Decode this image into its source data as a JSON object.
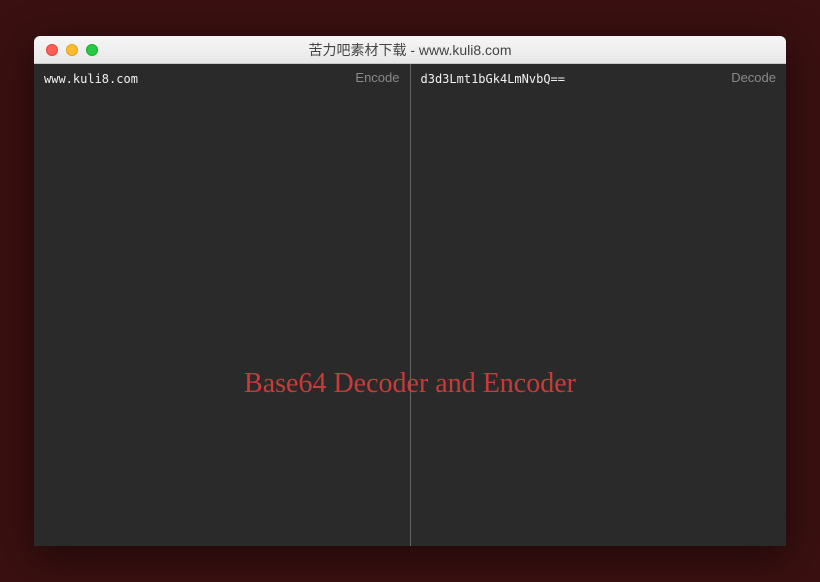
{
  "window": {
    "title": "苦力吧素材下载 - www.kuli8.com"
  },
  "panes": {
    "left": {
      "label": "Encode",
      "content": "www.kuli8.com"
    },
    "right": {
      "label": "Decode",
      "content": "d3d3Lmt1bGk4LmNvbQ=="
    }
  },
  "overlay": {
    "title": "Base64 Decoder and Encoder"
  },
  "colors": {
    "bg_outer": "#3a1010",
    "bg_pane": "#2a2a2a",
    "accent": "#c93b3b"
  }
}
